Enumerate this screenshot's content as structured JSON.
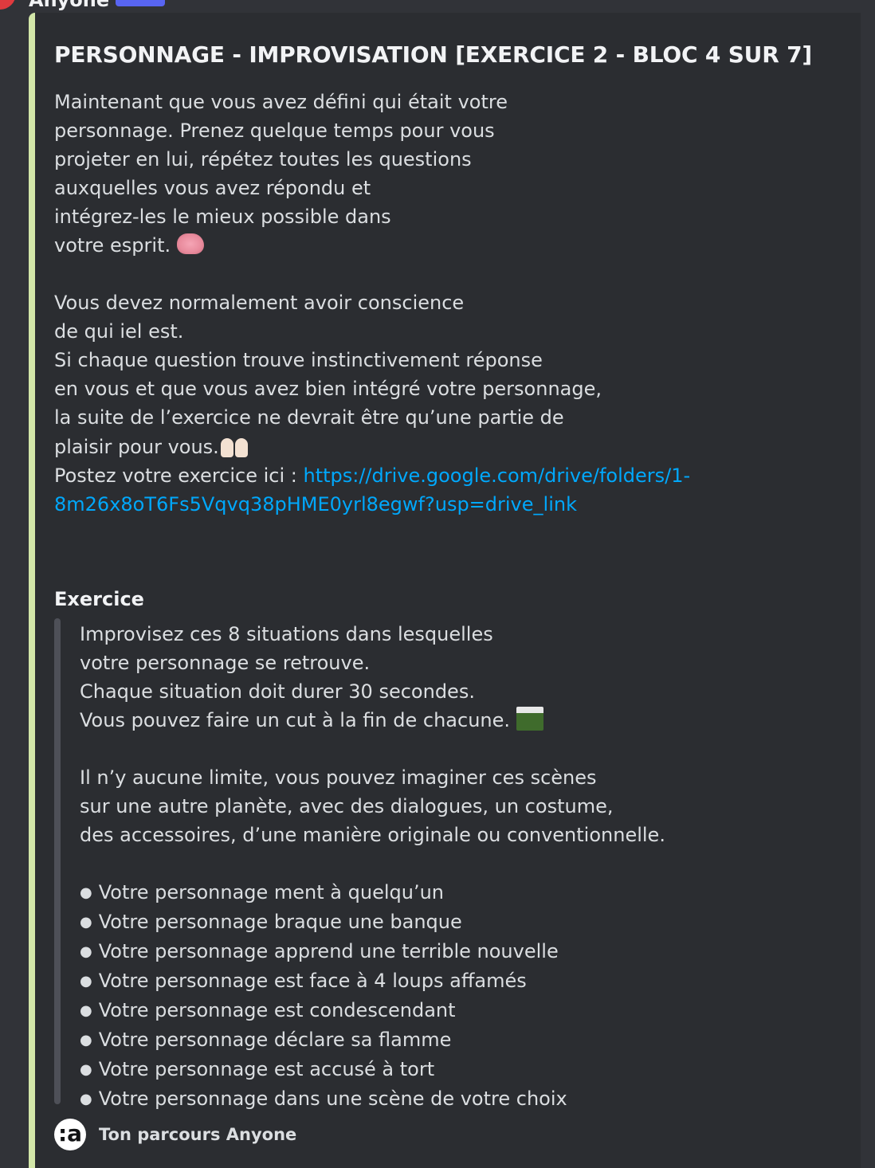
{
  "message": {
    "author_partial": "Anyone",
    "embed": {
      "accent_color": "#d3e7a9",
      "title": "PERSONNAGE - IMPROVISATION [EXERCICE 2 - BLOC 4 SUR 7]",
      "description": {
        "para1": [
          "Maintenant que vous avez défini qui était votre",
          "personnage. Prenez quelque temps pour vous",
          "projeter en lui, répétez toutes les questions",
          "auxquelles vous avez répondu et",
          "intégrez-les le mieux possible dans",
          "votre esprit."
        ],
        "para1_emoji": "brain-emoji",
        "para2": [
          "Vous devez normalement avoir conscience",
          "de qui iel est.",
          "Si chaque question trouve instinctivement réponse",
          "en vous et que vous avez bien intégré votre personnage,",
          "la suite de l’exercice ne devrait être qu’une partie de",
          "plaisir pour vous."
        ],
        "para2_emoji": "raised-hands-emoji",
        "post_label": "Postez votre exercice ici : ",
        "post_link_line1": "https://drive.google.com/drive/folders/1-",
        "post_link_line2": "8m26x8oT6Fs5Vqvq38pHME0yrl8egwf?usp=drive_link"
      },
      "field": {
        "name": "Exercice",
        "intro": [
          "Improvisez ces 8 situations dans lesquelles",
          "votre personnage se retrouve.",
          "Chaque situation doit durer 30 secondes.",
          "Vous pouvez faire un cut à la fin de chacune."
        ],
        "intro_emoji": "clapper-board-emoji",
        "rules": [
          "Il n’y aucune limite, vous pouvez imaginer ces scènes",
          "sur une autre planète, avec des dialogues, un costume,",
          "des accessoires, d’une manière originale ou conventionnelle."
        ],
        "situations": [
          "Votre personnage ment à quelqu’un",
          "Votre personnage braque une banque",
          "Votre personnage apprend une terrible nouvelle",
          "Votre personnage est face à 4 loups affamés",
          "Votre personnage est condescendant",
          "Votre personnage déclare sa flamme",
          "Votre personnage est accusé à tort",
          "Votre personnage dans une scène de votre choix"
        ]
      },
      "footer": {
        "icon_text": ":a",
        "text": "Ton parcours Anyone"
      }
    }
  }
}
